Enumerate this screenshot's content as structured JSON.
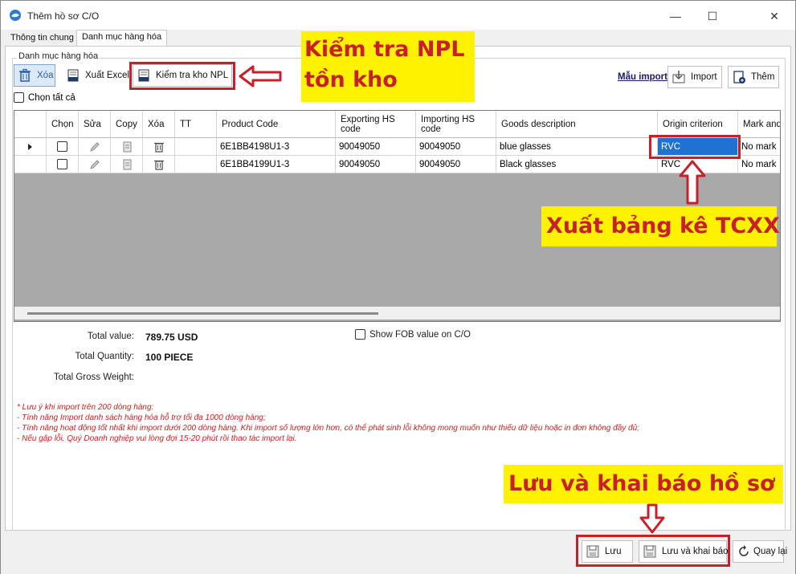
{
  "window": {
    "title": "Thêm hồ sơ C/O",
    "minimize": "—",
    "maximize": "☐",
    "close": "✕"
  },
  "tabs": [
    {
      "label": "Thông tin chung",
      "active": false
    },
    {
      "label": "Danh mục hàng hóa",
      "active": true
    }
  ],
  "group_label": "Danh mục hàng hóa",
  "toolbar": {
    "delete_label": "Xóa",
    "export_excel_label": "Xuất Excel",
    "check_npl_label": "Kiểm tra kho NPL",
    "import_template_link": "Mẫu import",
    "import_label": "Import",
    "add_label": "Thêm",
    "select_all_label": "Chọn tất cả"
  },
  "grid": {
    "headers": [
      "",
      "Chọn",
      "Sửa",
      "Copy",
      "Xóa",
      "TT",
      "Product Code",
      "Exporting HS code",
      "Importing HS code",
      "Goods description",
      "Origin criterion",
      "Mark and"
    ],
    "rows": [
      {
        "product_code": "6E1BB4198U1-3",
        "exporting_hs": "90049050",
        "importing_hs": "90049050",
        "description": "blue glasses",
        "origin": "RVC",
        "mark": "No mark",
        "current": true
      },
      {
        "product_code": "6E1BB4199U1-3",
        "exporting_hs": "90049050",
        "importing_hs": "90049050",
        "description": "Black glasses",
        "origin": "RVC",
        "mark": "No mark",
        "current": false
      }
    ]
  },
  "summary": {
    "total_value_label": "Total value:",
    "total_value": "789.75 USD",
    "total_quantity_label": "Total Quantity:",
    "total_quantity": "100 PIECE",
    "total_gross_weight_label": "Total Gross Weight:",
    "show_fob_label": "Show FOB value on C/O"
  },
  "notes": [
    "* Lưu ý khi import trên 200 dòng hàng:",
    "- Tính năng Import danh sách hàng hóa hỗ trợ tối đa 1000 dòng hàng;",
    "- Tính năng hoạt động tốt nhất khi import dưới 200 dòng hàng. Khi import số lượng lớn hơn, có thể phát sinh lỗi không mong muốn như thiếu dữ liệu hoặc in đơn không đầy đủ;",
    "- Nếu gặp lỗi, Quý Doanh nghiệp vui lòng đợi 15-20 phút rồi thao tác import lại."
  ],
  "bottom": {
    "save_label": "Lưu",
    "save_declare_label": "Lưu và khai báo",
    "back_label": "Quay lại"
  },
  "annotations": {
    "check_npl_line1": "Kiểm tra NPL",
    "check_npl_line2": "tồn kho",
    "export_tcxx": "Xuất bảng kê TCXX",
    "save_declare": "Lưu và khai báo hồ sơ"
  },
  "colors": {
    "annotation_red": "#c8202a",
    "annotation_yellow": "#fff200",
    "selection_blue": "#1e73d2",
    "note_red": "#d21d1d"
  }
}
